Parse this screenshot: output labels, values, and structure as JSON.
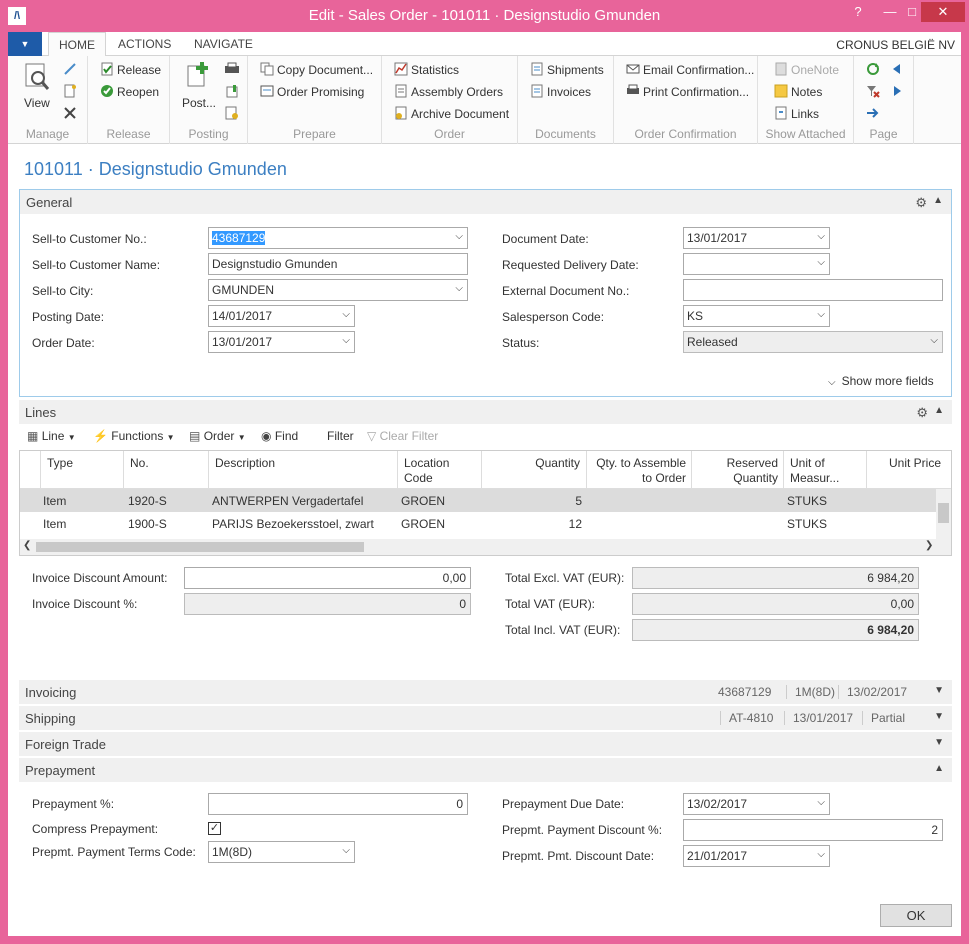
{
  "window": {
    "title": "Edit - Sales Order - 101011 · Designstudio Gmunden",
    "app_icon": "nav-logo-icon"
  },
  "tabs": [
    "HOME",
    "ACTIONS",
    "NAVIGATE"
  ],
  "company": "CRONUS BELGIË NV",
  "ribbon": {
    "manage": {
      "label": "Manage",
      "view": "View"
    },
    "release": {
      "label": "Release",
      "release": "Release",
      "reopen": "Reopen"
    },
    "posting": {
      "label": "Posting",
      "post": "Post..."
    },
    "prepare": {
      "label": "Prepare",
      "copy_document": "Copy Document...",
      "order_promising": "Order Promising"
    },
    "order": {
      "label": "Order",
      "statistics": "Statistics",
      "assembly_orders": "Assembly Orders",
      "archive_document": "Archive Document"
    },
    "documents": {
      "label": "Documents",
      "shipments": "Shipments",
      "invoices": "Invoices"
    },
    "order_confirmation": {
      "label": "Order Confirmation",
      "email": "Email Confirmation...",
      "print": "Print Confirmation..."
    },
    "show_attached": {
      "label": "Show Attached",
      "onenote": "OneNote",
      "notes": "Notes",
      "links": "Links"
    },
    "page": {
      "label": "Page"
    }
  },
  "page_title": "101011 · Designstudio Gmunden",
  "general": {
    "title": "General",
    "sell_to_customer_no": {
      "label": "Sell-to Customer No.:",
      "value": "43687129"
    },
    "sell_to_customer_name": {
      "label": "Sell-to Customer Name:",
      "value": "Designstudio Gmunden"
    },
    "sell_to_city": {
      "label": "Sell-to City:",
      "value": "GMUNDEN"
    },
    "posting_date": {
      "label": "Posting Date:",
      "value": "14/01/2017"
    },
    "order_date": {
      "label": "Order Date:",
      "value": "13/01/2017"
    },
    "document_date": {
      "label": "Document Date:",
      "value": "13/01/2017"
    },
    "requested_delivery_date": {
      "label": "Requested Delivery Date:",
      "value": ""
    },
    "external_document_no": {
      "label": "External Document No.:",
      "value": ""
    },
    "salesperson_code": {
      "label": "Salesperson Code:",
      "value": "KS"
    },
    "status": {
      "label": "Status:",
      "value": "Released"
    },
    "show_more": "Show more fields"
  },
  "lines": {
    "title": "Lines",
    "toolbar": {
      "line": "Line",
      "functions": "Functions",
      "order": "Order",
      "find": "Find",
      "filter": "Filter",
      "clear_filter": "Clear Filter"
    },
    "columns": {
      "type": "Type",
      "no": "No.",
      "description": "Description",
      "location_1": "Location",
      "location_2": "Code",
      "quantity": "Quantity",
      "qty_assemble_1": "Qty. to Assemble",
      "qty_assemble_2": "to Order",
      "reserved_1": "Reserved",
      "reserved_2": "Quantity",
      "uom_1": "Unit of",
      "uom_2": "Measur...",
      "unit_price": "Unit Price"
    },
    "rows": [
      {
        "type": "Item",
        "no": "1920-S",
        "description": "ANTWERPEN Vergadertafel",
        "location": "GROEN",
        "quantity": "5",
        "uom": "STUKS"
      },
      {
        "type": "Item",
        "no": "1900-S",
        "description": "PARIJS Bezoekersstoel, zwart",
        "location": "GROEN",
        "quantity": "12",
        "uom": "STUKS"
      }
    ]
  },
  "totals": {
    "invoice_discount_amount": {
      "label": "Invoice Discount Amount:",
      "value": "0,00"
    },
    "invoice_discount_pct": {
      "label": "Invoice Discount %:",
      "value": "0"
    },
    "total_excl_vat": {
      "label": "Total Excl. VAT (EUR):",
      "value": "6 984,20"
    },
    "total_vat": {
      "label": "Total VAT (EUR):",
      "value": "0,00"
    },
    "total_incl_vat": {
      "label": "Total Incl. VAT (EUR):",
      "value": "6 984,20"
    }
  },
  "invoicing": {
    "title": "Invoicing",
    "summary": [
      "43687129",
      "1M(8D)",
      "13/02/2017"
    ]
  },
  "shipping": {
    "title": "Shipping",
    "summary": [
      "AT-4810",
      "13/01/2017",
      "Partial"
    ]
  },
  "foreign_trade": {
    "title": "Foreign Trade"
  },
  "prepayment": {
    "title": "Prepayment",
    "prepayment_pct": {
      "label": "Prepayment %:",
      "value": "0"
    },
    "compress_prepayment": {
      "label": "Compress Prepayment:",
      "checked": "✓"
    },
    "prepmt_payment_terms_code": {
      "label": "Prepmt. Payment Terms Code:",
      "value": "1M(8D)"
    },
    "prepayment_due_date": {
      "label": "Prepayment Due Date:",
      "value": "13/02/2017"
    },
    "prepmt_payment_discount_pct": {
      "label": "Prepmt. Payment Discount %:",
      "value": "2"
    },
    "prepmt_pmt_discount_date": {
      "label": "Prepmt. Pmt. Discount Date:",
      "value": "21/01/2017"
    }
  },
  "ok": "OK",
  "colors": {
    "accent": "#3c7fc2",
    "frame": "#e8649a",
    "ribbon_blue": "#1e5ba8"
  }
}
